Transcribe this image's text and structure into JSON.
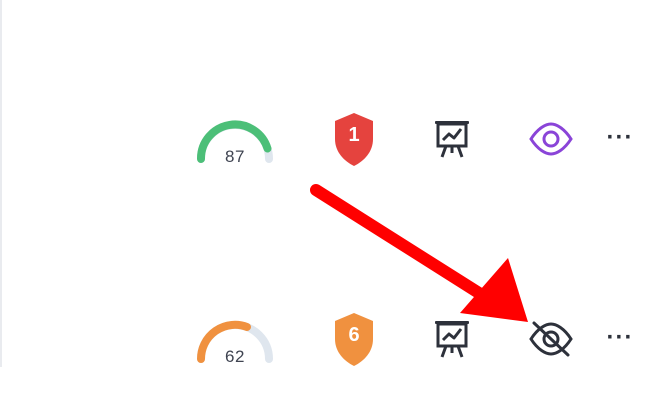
{
  "rows": [
    {
      "score": "87",
      "score_level": 0.87,
      "score_color": "#4cbf78",
      "issue_count": "1",
      "issue_color": "#e5433e",
      "presentation_icon": "presentation-chart-icon",
      "visibility_icon": "eye-icon",
      "visibility_color": "#8a44d8",
      "more_label": "···"
    },
    {
      "score": "62",
      "score_level": 0.62,
      "score_color": "#f0913f",
      "issue_count": "6",
      "issue_color": "#f0913f",
      "presentation_icon": "presentation-chart-icon",
      "visibility_icon": "eye-off-icon",
      "visibility_color": "#2d313b",
      "more_label": "···"
    }
  ],
  "colors": {
    "gauge_track": "#dfe6ee",
    "icon_dark": "#2d313b",
    "annotation_arrow": "#ff0000"
  }
}
